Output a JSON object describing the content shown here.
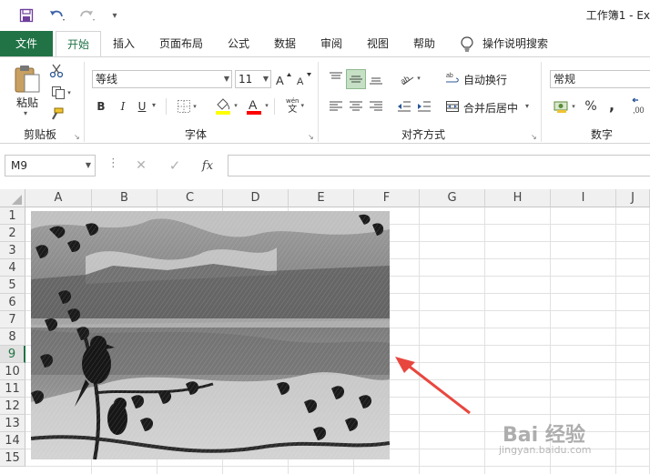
{
  "quick_access": {
    "save_icon": "save-icon",
    "undo_icon": "undo-icon",
    "redo_icon": "redo-icon",
    "customize_icon": "customize-qat-icon"
  },
  "window": {
    "title": "工作簿1  -  Ex"
  },
  "tabs": [
    {
      "label": "文件"
    },
    {
      "label": "开始"
    },
    {
      "label": "插入"
    },
    {
      "label": "页面布局"
    },
    {
      "label": "公式"
    },
    {
      "label": "数据"
    },
    {
      "label": "审阅"
    },
    {
      "label": "视图"
    },
    {
      "label": "帮助"
    },
    {
      "label": "操作说明搜索"
    }
  ],
  "ribbon": {
    "clipboard": {
      "paste_label": "粘贴",
      "group_label": "剪贴板"
    },
    "font": {
      "font_name": "等线",
      "font_size": "11",
      "bold": "B",
      "italic": "I",
      "underline": "U",
      "font_color_glyph": "A",
      "phonetic_glyph": "wén",
      "group_label": "字体",
      "fill_color": "#ffff00",
      "font_color": "#ff0000"
    },
    "alignment": {
      "wrap_text": "自动换行",
      "merge_center": "合并后居中",
      "group_label": "对齐方式"
    },
    "number": {
      "format": "常规",
      "percent": "%",
      "comma": ",",
      "group_label": "数字"
    }
  },
  "formula_bar": {
    "name_box": "M9",
    "cancel_glyph": "✕",
    "enter_glyph": "✓",
    "fx_glyph": "fx",
    "value": ""
  },
  "grid": {
    "columns": [
      "A",
      "B",
      "C",
      "D",
      "E",
      "F",
      "G",
      "H",
      "I",
      "J"
    ],
    "rows": [
      "1",
      "2",
      "3",
      "4",
      "5",
      "6",
      "7",
      "8",
      "9",
      "10",
      "11",
      "12",
      "13",
      "14",
      "15"
    ],
    "selected_row": "9"
  },
  "watermark": {
    "text": "Bai 经验",
    "url": "jingyan.baidu.com"
  },
  "colors": {
    "accent": "#217346",
    "arrow": "#e8473f"
  }
}
